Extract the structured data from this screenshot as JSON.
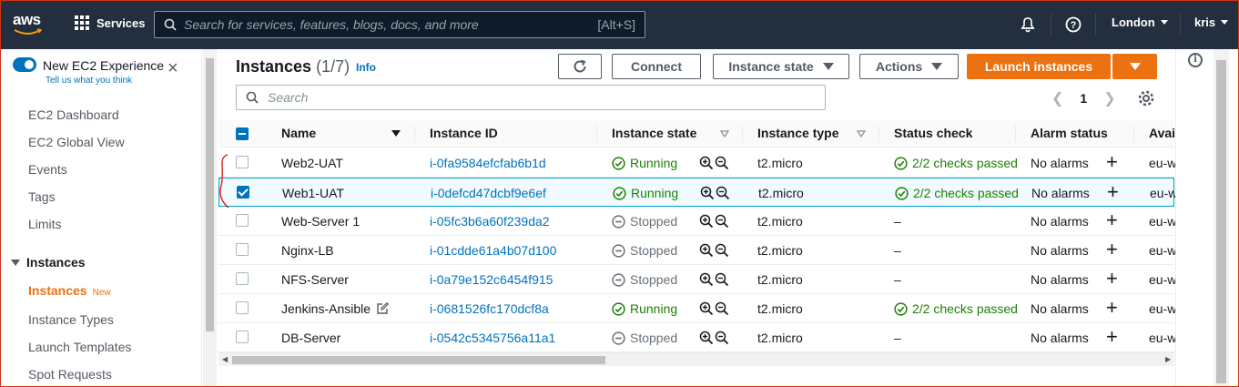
{
  "topnav": {
    "logo_text": "aws",
    "services_label": "Services",
    "search_placeholder": "Search for services, features, blogs, docs, and more",
    "search_shortcut": "[Alt+S]",
    "region": "London",
    "user": "kris"
  },
  "sidebar": {
    "experience_title": "New EC2 Experience",
    "experience_link": "Tell us what you think",
    "items": [
      "EC2 Dashboard",
      "EC2 Global View",
      "Events",
      "Tags",
      "Limits"
    ],
    "section_title": "Instances",
    "section_items": [
      {
        "label": "Instances",
        "badge": "New"
      },
      {
        "label": "Instance Types"
      },
      {
        "label": "Launch Templates"
      },
      {
        "label": "Spot Requests"
      }
    ]
  },
  "main": {
    "title": "Instances",
    "count": "(1/7)",
    "info": "Info",
    "buttons": {
      "connect": "Connect",
      "instance_state": "Instance state",
      "actions": "Actions",
      "launch": "Launch instances"
    },
    "search_placeholder": "Search",
    "page": "1"
  },
  "table": {
    "columns": [
      "Name",
      "Instance ID",
      "Instance state",
      "Instance type",
      "Status check",
      "Alarm status",
      "Avai"
    ],
    "rows": [
      {
        "name": "Web2-UAT",
        "id": "i-0fa9584efcfab6b1d",
        "state": "Running",
        "type": "t2.micro",
        "check": "2/2 checks passed",
        "alarm": "No alarms",
        "avail": "eu-w",
        "selected": false
      },
      {
        "name": "Web1-UAT",
        "id": "i-0defcd47dcbf9e6ef",
        "state": "Running",
        "type": "t2.micro",
        "check": "2/2 checks passed",
        "alarm": "No alarms",
        "avail": "eu-w",
        "selected": true
      },
      {
        "name": "Web-Server 1",
        "id": "i-05fc3b6a60f239da2",
        "state": "Stopped",
        "type": "t2.micro",
        "check": "–",
        "alarm": "No alarms",
        "avail": "eu-w",
        "selected": false
      },
      {
        "name": "Nginx-LB",
        "id": "i-01cdde61a4b07d100",
        "state": "Stopped",
        "type": "t2.micro",
        "check": "–",
        "alarm": "No alarms",
        "avail": "eu-w",
        "selected": false
      },
      {
        "name": "NFS-Server",
        "id": "i-0a79e152c6454f915",
        "state": "Stopped",
        "type": "t2.micro",
        "check": "–",
        "alarm": "No alarms",
        "avail": "eu-w",
        "selected": false
      },
      {
        "name": "Jenkins-Ansible",
        "id": "i-0681526fc170dcf8a",
        "state": "Running",
        "type": "t2.micro",
        "check": "2/2 checks passed",
        "alarm": "No alarms",
        "avail": "eu-w",
        "selected": false
      },
      {
        "name": "DB-Server",
        "id": "i-0542c5345756a11a1",
        "state": "Stopped",
        "type": "t2.micro",
        "check": "–",
        "alarm": "No alarms",
        "avail": "eu-w",
        "selected": false
      }
    ]
  },
  "colors": {
    "nav_bg": "#232f3e",
    "accent": "#ec7211",
    "link": "#0073bb",
    "running": "#1d8102",
    "stopped": "#687078"
  },
  "icons": {
    "zoom": [
      "zoom-in-icon",
      "zoom-out-icon"
    ],
    "edit": "edit-icon",
    "add": "plus-icon"
  }
}
